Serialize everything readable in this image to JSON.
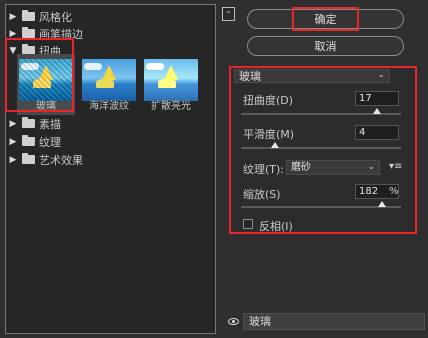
{
  "tree": {
    "folders_top": [
      {
        "label": "风格化",
        "expanded": false
      },
      {
        "label": "画笔描边",
        "expanded": false
      },
      {
        "label": "扭曲",
        "expanded": true
      }
    ],
    "thumbnails": [
      {
        "label": "玻璃",
        "selected": true
      },
      {
        "label": "海洋波纹",
        "selected": false
      },
      {
        "label": "扩散亮光",
        "selected": false
      }
    ],
    "folders_bottom": [
      {
        "label": "素描",
        "expanded": false
      },
      {
        "label": "纹理",
        "expanded": false
      },
      {
        "label": "艺术效果",
        "expanded": false
      }
    ]
  },
  "buttons": {
    "collapse_glyph": "⌃",
    "ok_label": "确定",
    "cancel_label": "取消"
  },
  "settings": {
    "filter_name": "玻璃",
    "distortion": {
      "label": "扭曲度(D)",
      "value": "17",
      "level": 17
    },
    "smoothness": {
      "label": "平滑度(M)",
      "value": "4",
      "level": 4
    },
    "texture": {
      "label": "纹理(T):",
      "value": "磨砂"
    },
    "scaling": {
      "label": "缩放(S)",
      "value": "182",
      "unit": "%",
      "level": 182
    },
    "invert": {
      "label": "反相(I)",
      "checked": false
    }
  },
  "layer": {
    "name": "玻璃",
    "visible": true
  },
  "colors": {
    "highlight": "#e8262a",
    "panel_bg": "#262626",
    "app_bg": "#2f2f2f"
  }
}
